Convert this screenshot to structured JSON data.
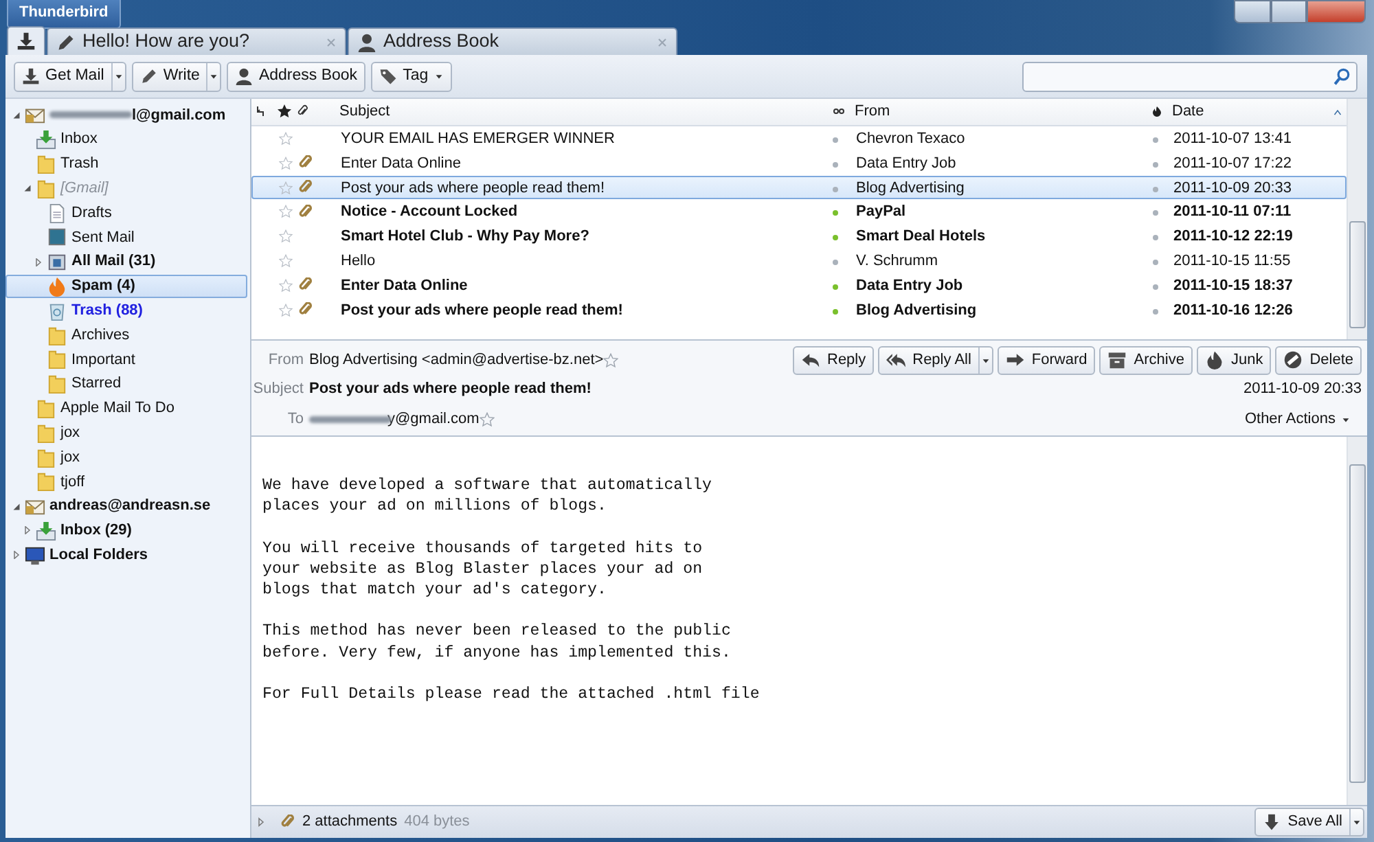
{
  "app_menu": {
    "label": "Thunderbird"
  },
  "tabs": [
    {
      "kind": "home",
      "selected": true
    },
    {
      "kind": "compose",
      "label": "Hello! How are you?",
      "selected": false
    },
    {
      "kind": "addressbook",
      "label": "Address Book",
      "selected": false
    }
  ],
  "toolbar": [
    {
      "label": "Get Mail",
      "kind": "download",
      "split": true,
      "menu": false
    },
    {
      "label": "Write",
      "kind": "pencil",
      "split": true,
      "menu": false
    },
    {
      "label": "Address Book",
      "kind": "person",
      "split": false,
      "menu": false
    },
    {
      "label": "Tag",
      "kind": "tag",
      "split": false,
      "menu": true
    }
  ],
  "folders": [
    {
      "label": "l@gmail.com",
      "kind": "account",
      "redacted": true,
      "bold": true,
      "italic": false,
      "new": false,
      "expanded": true,
      "selected": false,
      "children": [
        {
          "label": "Inbox",
          "kind": "inbox",
          "bold": false,
          "italic": false,
          "new": false,
          "selected": false
        },
        {
          "label": "Trash",
          "kind": "folder",
          "bold": false,
          "italic": false,
          "new": false,
          "selected": false
        },
        {
          "label": "[Gmail]",
          "kind": "folder",
          "bold": false,
          "italic": true,
          "new": false,
          "expanded": true,
          "selected": false,
          "children": [
            {
              "label": "Drafts",
              "kind": "drafts",
              "bold": false,
              "italic": false,
              "new": false,
              "selected": false
            },
            {
              "label": "Sent Mail",
              "kind": "sent",
              "bold": false,
              "italic": false,
              "new": false,
              "selected": false
            },
            {
              "label": "All Mail (31)",
              "kind": "allmail",
              "bold": true,
              "italic": false,
              "new": false,
              "expanded": false,
              "selected": false
            },
            {
              "label": "Spam (4)",
              "kind": "spam",
              "bold": true,
              "italic": false,
              "new": false,
              "selected": true
            },
            {
              "label": "Trash (88)",
              "kind": "trash",
              "bold": true,
              "italic": false,
              "new": true,
              "selected": false
            },
            {
              "label": "Archives",
              "kind": "folder",
              "bold": false,
              "italic": false,
              "new": false,
              "selected": false
            },
            {
              "label": "Important",
              "kind": "folder",
              "bold": false,
              "italic": false,
              "new": false,
              "selected": false
            },
            {
              "label": "Starred",
              "kind": "folder",
              "bold": false,
              "italic": false,
              "new": false,
              "selected": false
            }
          ]
        },
        {
          "label": "Apple Mail To Do",
          "kind": "folder",
          "bold": false,
          "italic": false,
          "new": false,
          "selected": false
        },
        {
          "label": "jox",
          "kind": "folder",
          "bold": false,
          "italic": false,
          "new": false,
          "selected": false
        },
        {
          "label": "jox",
          "kind": "folder",
          "bold": false,
          "italic": false,
          "new": false,
          "selected": false
        },
        {
          "label": "tjoff",
          "kind": "folder",
          "bold": false,
          "italic": false,
          "new": false,
          "selected": false
        }
      ]
    },
    {
      "label": "andreas@andreasn.se",
      "kind": "account",
      "bold": true,
      "italic": false,
      "new": false,
      "expanded": true,
      "selected": false,
      "children": [
        {
          "label": "Inbox (29)",
          "kind": "inbox",
          "bold": true,
          "italic": false,
          "new": false,
          "expanded": false,
          "selected": false
        }
      ]
    },
    {
      "label": "Local Folders",
      "kind": "local",
      "bold": true,
      "italic": false,
      "new": false,
      "expanded": false,
      "selected": false
    }
  ],
  "messages": {
    "columns": [
      "Subject",
      "From",
      "Date"
    ],
    "rows": [
      {
        "subject": "YOUR EMAIL HAS EMERGER WINNER",
        "from": "Chevron Texaco",
        "date": "2011-10-07 13:41",
        "starred": false,
        "attachment": false,
        "unread": false,
        "selected": false
      },
      {
        "subject": "Enter Data Online",
        "from": "Data Entry Job",
        "date": "2011-10-07 17:22",
        "starred": false,
        "attachment": true,
        "unread": false,
        "selected": false
      },
      {
        "subject": "Post your ads where people read them!",
        "from": "Blog Advertising",
        "date": "2011-10-09 20:33",
        "starred": false,
        "attachment": true,
        "unread": false,
        "selected": true
      },
      {
        "subject": "Notice - Account Locked",
        "from": "PayPal",
        "date": "2011-10-11 07:11",
        "starred": false,
        "attachment": true,
        "unread": true,
        "selected": false
      },
      {
        "subject": "Smart Hotel Club - Why Pay More?",
        "from": "Smart Deal Hotels",
        "date": "2011-10-12 22:19",
        "starred": false,
        "attachment": false,
        "unread": true,
        "selected": false
      },
      {
        "subject": "Hello",
        "from": "V. Schrumm",
        "date": "2011-10-15 11:55",
        "starred": false,
        "attachment": false,
        "unread": false,
        "selected": false
      },
      {
        "subject": "Enter Data Online",
        "from": "Data Entry Job",
        "date": "2011-10-15 18:37",
        "starred": false,
        "attachment": true,
        "unread": true,
        "selected": false
      },
      {
        "subject": "Post your ads where people read them!",
        "from": "Blog Advertising",
        "date": "2011-10-16 12:26",
        "starred": false,
        "attachment": true,
        "unread": true,
        "selected": false
      }
    ]
  },
  "header": {
    "from_label": "From",
    "from": "Blog Advertising <admin@advertise-bz.net>",
    "subject_label": "Subject",
    "subject": "Post your ads where people read them!",
    "to_label": "To",
    "to": "y@gmail.com",
    "to_redacted": true,
    "date": "2011-10-09 20:33",
    "buttons": [
      {
        "label": "Reply",
        "kind": "reply",
        "dropdown": false
      },
      {
        "label": "Reply All",
        "kind": "replyall",
        "dropdown": true
      },
      {
        "label": "Forward",
        "kind": "forward",
        "dropdown": false
      },
      {
        "label": "Archive",
        "kind": "archive",
        "dropdown": false
      },
      {
        "label": "Junk",
        "kind": "junk",
        "dropdown": false
      },
      {
        "label": "Delete",
        "kind": "delete",
        "dropdown": false
      }
    ],
    "other_actions": "Other Actions"
  },
  "body": [
    [
      "We have developed a software that automatically",
      "places your ad on millions of blogs."
    ],
    [
      "You will receive thousands of targeted hits to",
      "your website as Blog Blaster places your ad on",
      "blogs that match your ad's category."
    ],
    [
      "This method has never been released to the public",
      "before. Very few, if anyone has implemented this."
    ],
    [
      "For Full Details please read the attached .html file"
    ]
  ],
  "attachments": {
    "count": "2 attachments",
    "size": "404 bytes",
    "save": "Save All"
  }
}
